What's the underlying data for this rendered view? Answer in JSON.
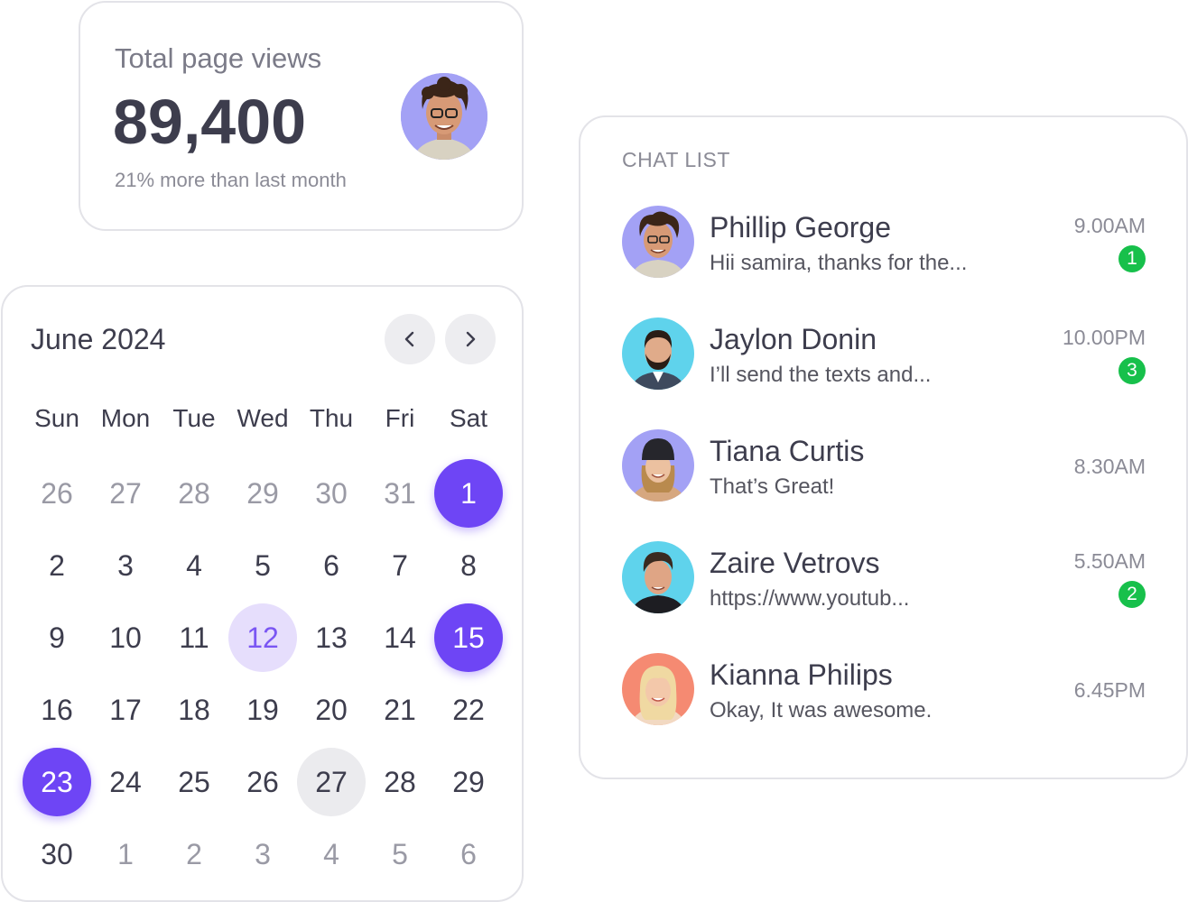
{
  "page_views": {
    "title": "Total page views",
    "value": "89,400",
    "subtitle": "21% more than last month",
    "avatar": "person-avatar",
    "avatar_bg": "#a3a1f5"
  },
  "calendar": {
    "month_label": "June 2024",
    "prev_icon": "chevron-left-icon",
    "next_icon": "chevron-right-icon",
    "weekdays": [
      "Sun",
      "Mon",
      "Tue",
      "Wed",
      "Thu",
      "Fri",
      "Sat"
    ],
    "weeks": [
      [
        {
          "d": "26",
          "muted": true
        },
        {
          "d": "27",
          "muted": true
        },
        {
          "d": "28",
          "muted": true
        },
        {
          "d": "29",
          "muted": true
        },
        {
          "d": "30",
          "muted": true
        },
        {
          "d": "31",
          "muted": true
        },
        {
          "d": "1",
          "state": "selected"
        }
      ],
      [
        {
          "d": "2"
        },
        {
          "d": "3"
        },
        {
          "d": "4"
        },
        {
          "d": "5"
        },
        {
          "d": "6"
        },
        {
          "d": "7"
        },
        {
          "d": "8"
        }
      ],
      [
        {
          "d": "9"
        },
        {
          "d": "10"
        },
        {
          "d": "11"
        },
        {
          "d": "12",
          "state": "today"
        },
        {
          "d": "13"
        },
        {
          "d": "14"
        },
        {
          "d": "15",
          "state": "selected"
        }
      ],
      [
        {
          "d": "16"
        },
        {
          "d": "17"
        },
        {
          "d": "18"
        },
        {
          "d": "19"
        },
        {
          "d": "20"
        },
        {
          "d": "21"
        },
        {
          "d": "22"
        }
      ],
      [
        {
          "d": "23",
          "state": "selected"
        },
        {
          "d": "24"
        },
        {
          "d": "25"
        },
        {
          "d": "26"
        },
        {
          "d": "27",
          "state": "hover"
        },
        {
          "d": "28"
        },
        {
          "d": "29"
        }
      ],
      [
        {
          "d": "30"
        },
        {
          "d": "1",
          "muted": true
        },
        {
          "d": "2",
          "muted": true
        },
        {
          "d": "3",
          "muted": true
        },
        {
          "d": "4",
          "muted": true
        },
        {
          "d": "5",
          "muted": true
        },
        {
          "d": "6",
          "muted": true
        }
      ]
    ],
    "colors": {
      "selected": "#6e45f5",
      "today_bg": "#e6defc",
      "hover_bg": "#ebebee"
    }
  },
  "chat_list": {
    "heading": "CHAT LIST",
    "items": [
      {
        "name": "Phillip George",
        "preview": "Hii samira, thanks for the...",
        "time": "9.00AM",
        "unread": "1",
        "avatar_bg": "#a3a1f5",
        "avatar": "curly-hair-man-avatar"
      },
      {
        "name": "Jaylon Donin",
        "preview": "I’ll send the texts and...",
        "time": "10.00PM",
        "unread": "3",
        "avatar_bg": "#5fd3ec",
        "avatar": "bearded-man-avatar"
      },
      {
        "name": "Tiana Curtis",
        "preview": "That’s Great!",
        "time": "8.30AM",
        "unread": "",
        "avatar_bg": "#a3a1f5",
        "avatar": "woman-beanie-avatar"
      },
      {
        "name": "Zaire Vetrovs",
        "preview": "https://www.youtub...",
        "time": "5.50AM",
        "unread": "2",
        "avatar_bg": "#5fd3ec",
        "avatar": "young-man-avatar"
      },
      {
        "name": "Kianna Philips",
        "preview": "Okay, It was awesome.",
        "time": "6.45PM",
        "unread": "",
        "avatar_bg": "#f58a72",
        "avatar": "blonde-woman-avatar"
      }
    ],
    "badge_color": "#17c04b"
  }
}
